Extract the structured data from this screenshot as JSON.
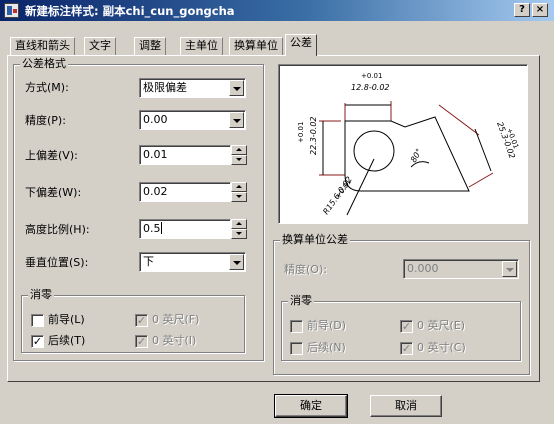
{
  "window": {
    "title": "新建标注样式: 副本chi_cun_gongcha",
    "help_button": "?",
    "close_button": "×"
  },
  "tabs": [
    {
      "label": "直线和箭头",
      "active": false
    },
    {
      "label": "文字",
      "active": false
    },
    {
      "label": "调整",
      "active": false
    },
    {
      "label": "主单位",
      "active": false
    },
    {
      "label": "换算单位",
      "active": false
    },
    {
      "label": "公差",
      "active": true
    }
  ],
  "tolerance_format": {
    "title": "公差格式",
    "method": {
      "label": "方式(M):",
      "value": "极限偏差"
    },
    "precision": {
      "label": "精度(P):",
      "value": "0.00"
    },
    "upper_value": {
      "label": "上偏差(V):",
      "value": "0.01"
    },
    "lower_value": {
      "label": "下偏差(W):",
      "value": "0.02"
    },
    "scaling_height": {
      "label": "高度比例(H):",
      "value": "0.5"
    },
    "vertical_position": {
      "label": "垂直位置(S):",
      "value": "下"
    },
    "zero_suppression": {
      "title": "消零",
      "leading": {
        "label": "前导(L)",
        "checked": false
      },
      "trailing": {
        "label": "后续(T)",
        "checked": true
      },
      "feet": {
        "label": "0 英尺(F)",
        "checked": true,
        "disabled": true
      },
      "inches": {
        "label": "0 英寸(I)",
        "checked": true,
        "disabled": true
      }
    }
  },
  "preview": {
    "dim_top_upper": "+0.01",
    "dim_top_main": "12.8-0.02",
    "dim_left_upper": "+0.01",
    "dim_left_main": "22.3-0.02",
    "dim_right_upper": "+0.01",
    "dim_right_main": "25.3-0.02",
    "dim_diag_upper": "+0.01",
    "dim_diag_main": "R15.6-0.02",
    "dim_angle": "80°",
    "stroke_color": "#000000",
    "extension_color": "#8b1a1a"
  },
  "alt_unit_tolerance": {
    "title": "换算单位公差",
    "precision": {
      "label": "精度(O):",
      "value": "0.000"
    },
    "zero_suppression": {
      "title": "消零",
      "leading": {
        "label": "前导(D)",
        "checked": false
      },
      "trailing": {
        "label": "后续(N)",
        "checked": false
      },
      "feet": {
        "label": "0 英尺(E)",
        "checked": true
      },
      "inches": {
        "label": "0 英寸(C)",
        "checked": true
      }
    }
  },
  "buttons": {
    "ok": "确定",
    "cancel": "取消"
  },
  "colors": {
    "titlebar_start": "#0a246a",
    "titlebar_end": "#a6caf0",
    "face": "#d4d0c8"
  }
}
